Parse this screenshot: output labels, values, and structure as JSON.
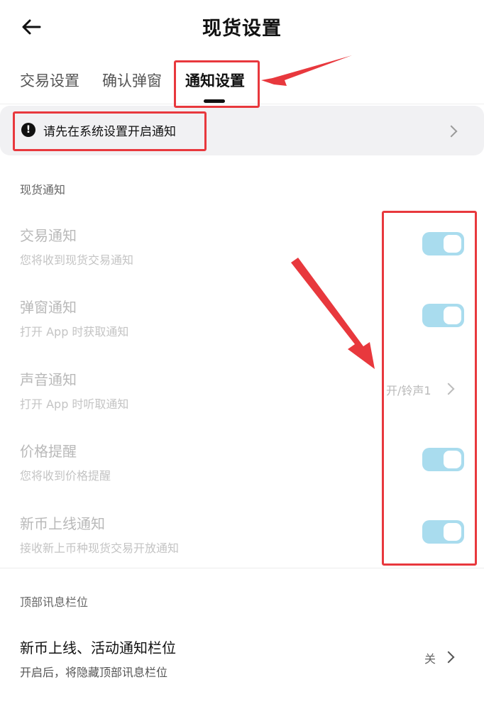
{
  "header": {
    "title": "现货设置"
  },
  "tabs": [
    {
      "label": "交易设置"
    },
    {
      "label": "确认弹窗"
    },
    {
      "label": "通知设置"
    }
  ],
  "banner": {
    "icon": "warning-icon",
    "text": "请先在系统设置开启通知"
  },
  "spot_notifications": {
    "section_label": "现货通知",
    "rows": [
      {
        "title": "交易通知",
        "subtitle": "您将收到现货交易通知",
        "control": "toggle",
        "enabled": true
      },
      {
        "title": "弹窗通知",
        "subtitle": "打开 App 时获取通知",
        "control": "toggle",
        "enabled": true
      },
      {
        "title": "声音通知",
        "subtitle": "打开 App 时听取通知",
        "control": "value",
        "value": "开/铃声1"
      },
      {
        "title": "价格提醒",
        "subtitle": "您将收到价格提醒",
        "control": "toggle",
        "enabled": true
      },
      {
        "title": "新币上线通知",
        "subtitle": "接收新上币种现货交易开放通知",
        "control": "toggle",
        "enabled": true
      }
    ]
  },
  "top_message": {
    "section_label": "顶部讯息栏位",
    "row": {
      "title": "新币上线、活动通知栏位",
      "subtitle": "开启后，将隐藏顶部讯息栏位",
      "value": "关"
    }
  },
  "colors": {
    "annotation_red": "#e8383d",
    "toggle_on": "#a9dcee",
    "banner_bg": "#f1f1f3"
  }
}
